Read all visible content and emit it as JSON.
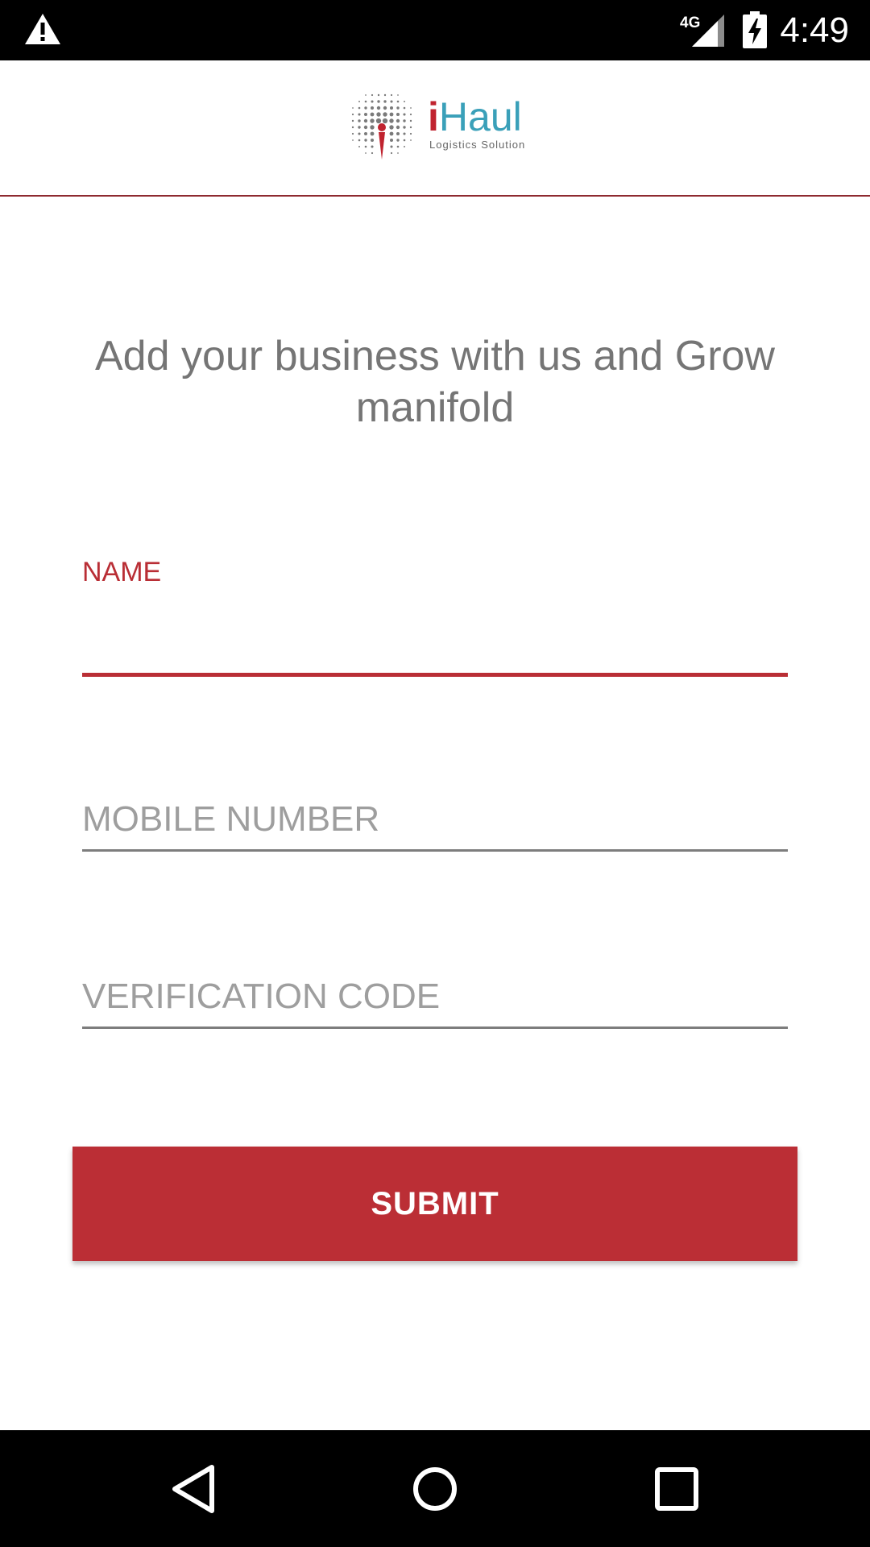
{
  "status_bar": {
    "time": "4:49",
    "network_label": "4G",
    "icons": [
      "warning-icon",
      "signal-icon",
      "battery-charging-icon"
    ]
  },
  "header": {
    "logo": {
      "brand_i": "i",
      "brand_rest": "Haul",
      "tagline": "Logistics Solution",
      "colors": {
        "red": "#c0232f",
        "teal": "#3aa0b9"
      }
    }
  },
  "main": {
    "headline": "Add your business with us and Grow manifold",
    "fields": {
      "name": {
        "label": "NAME",
        "value": ""
      },
      "mobile": {
        "placeholder": "MOBILE NUMBER",
        "value": ""
      },
      "verification": {
        "placeholder": "VERIFICATION CODE",
        "value": ""
      }
    },
    "submit_label": "SUBMIT"
  },
  "nav_bar": {
    "icons": [
      "back-icon",
      "home-icon",
      "recents-icon"
    ]
  },
  "colors": {
    "accent": "#bb2e35",
    "header_divider": "#8e2a30",
    "text_muted": "#757575",
    "placeholder": "#9e9e9e"
  }
}
